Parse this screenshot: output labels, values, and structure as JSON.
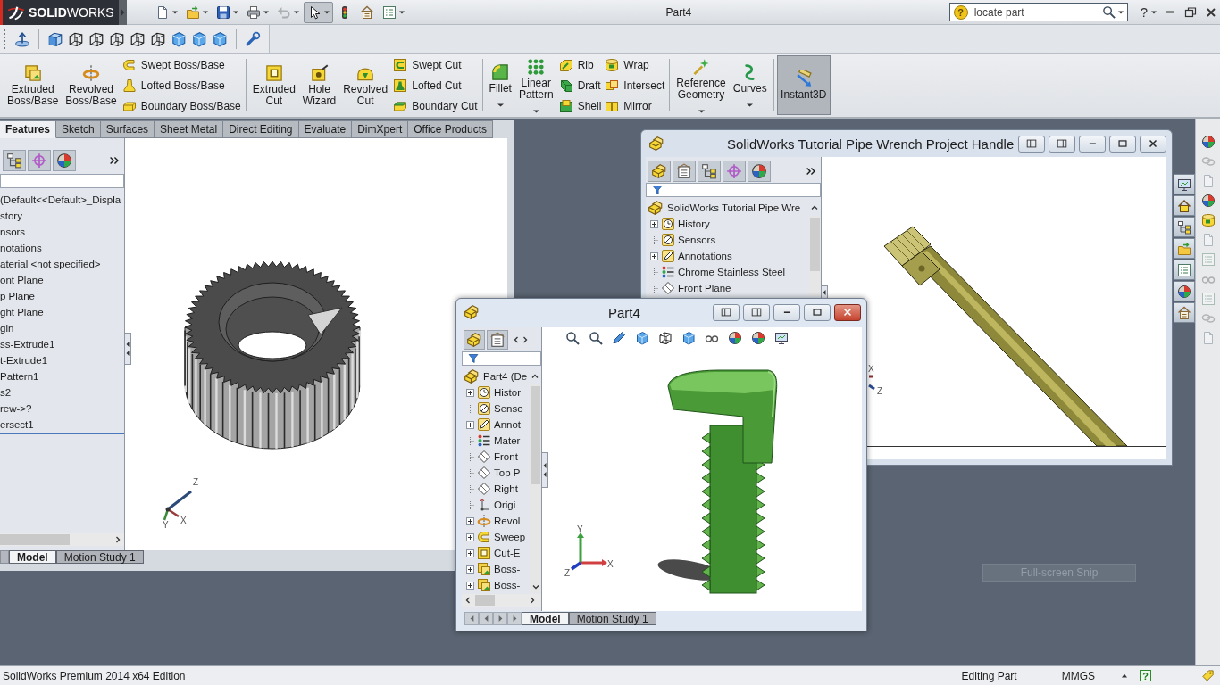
{
  "titlebar": {
    "logo": "**SOLID**WORKS",
    "title": "Part4",
    "search": {
      "help": "?",
      "placeholder": "locate part"
    },
    "help": "?"
  },
  "quick_access": [
    {
      "dropdown": true,
      "disabled": false,
      "pressed": false
    },
    {
      "dropdown": true,
      "disabled": false,
      "pressed": false
    },
    {
      "dropdown": true,
      "disabled": false,
      "pressed": false
    },
    {
      "dropdown": true,
      "disabled": false,
      "pressed": false
    },
    {
      "dropdown": true,
      "disabled": true,
      "pressed": false
    },
    {
      "dropdown": true,
      "disabled": false,
      "pressed": true
    },
    {
      "dropdown": false,
      "disabled": false,
      "pressed": false
    },
    {
      "dropdown": false,
      "disabled": false,
      "pressed": false
    },
    {
      "dropdown": true,
      "disabled": false,
      "pressed": false
    }
  ],
  "ribbon": {
    "groups": [
      {
        "items": [
          {
            "kind": "large",
            "label": "Extruded Boss/Base",
            "dropdown": false
          },
          {
            "kind": "large",
            "label": "Revolved Boss/Base",
            "dropdown": false
          },
          {
            "kind": "stack",
            "items": [
              "Swept Boss/Base",
              "Lofted Boss/Base",
              "Boundary Boss/Base"
            ]
          }
        ]
      },
      {
        "items": [
          {
            "kind": "large",
            "label": "Extruded Cut",
            "dropdown": false
          },
          {
            "kind": "large",
            "label": "Hole Wizard",
            "dropdown": false
          },
          {
            "kind": "large",
            "label": "Revolved Cut",
            "dropdown": false
          },
          {
            "kind": "stack",
            "items": [
              "Swept Cut",
              "Lofted Cut",
              "Boundary Cut"
            ]
          }
        ]
      },
      {
        "items": [
          {
            "kind": "large",
            "label": "Fillet",
            "dropdown": true
          },
          {
            "kind": "large",
            "label": "Linear Pattern",
            "dropdown": true
          },
          {
            "kind": "stack",
            "items": [
              "Rib",
              "Draft",
              "Shell"
            ]
          },
          {
            "kind": "stack",
            "items": [
              "Wrap",
              "Intersect",
              "Mirror"
            ]
          }
        ]
      },
      {
        "items": [
          {
            "kind": "large",
            "label": "Reference Geometry",
            "dropdown": true
          },
          {
            "kind": "large",
            "label": "Curves",
            "dropdown": true
          }
        ]
      }
    ],
    "toggle": {
      "label": "Instant3D",
      "on": true
    }
  },
  "tabs": [
    {
      "label": "Features",
      "selected": true
    },
    {
      "label": "Sketch",
      "selected": false
    },
    {
      "label": "Surfaces",
      "selected": false
    },
    {
      "label": "Sheet Metal",
      "selected": false
    },
    {
      "label": "Direct Editing",
      "selected": false
    },
    {
      "label": "Evaluate",
      "selected": false
    },
    {
      "label": "DimXpert",
      "selected": false
    },
    {
      "label": "Office Products",
      "selected": false
    }
  ],
  "main_document": {
    "tree": [
      "(Default<<Default>_Displa",
      "story",
      "nsors",
      "notations",
      "aterial <not specified>",
      "ont Plane",
      "p Plane",
      "ght Plane",
      "gin",
      "ss-Extrude1",
      "t-Extrude1",
      "Pattern1",
      "s2",
      "rew->?",
      "ersect1"
    ],
    "triad": [
      "Z",
      "X",
      "Y"
    ],
    "bottom_tabs": [
      {
        "label": "Model",
        "selected": true
      },
      {
        "label": "Motion Study 1",
        "selected": false
      }
    ]
  },
  "handle_window": {
    "title": "SolidWorks Tutorial Pipe Wrench Project Handle",
    "active": false,
    "tree": {
      "root": "SolidWorks Tutorial Pipe Wre",
      "items": [
        {
          "kind": "history",
          "label": "History",
          "expandable": true
        },
        {
          "kind": "sensors",
          "label": "Sensors",
          "expandable": false
        },
        {
          "kind": "annotations",
          "label": "Annotations",
          "expandable": true
        },
        {
          "kind": "material",
          "label": "Chrome Stainless Steel",
          "expandable": false
        },
        {
          "kind": "plane",
          "label": "Front Plane",
          "expandable": false
        }
      ]
    },
    "triad": [
      "X",
      "Z"
    ]
  },
  "part_window": {
    "title": "Part4",
    "active": true,
    "tree": {
      "root": "Part4 (De",
      "items": [
        {
          "kind": "history",
          "label": "Histor",
          "expandable": true
        },
        {
          "kind": "sensors",
          "label": "Senso",
          "expandable": false
        },
        {
          "kind": "annotations",
          "label": "Annot",
          "expandable": true
        },
        {
          "kind": "material",
          "label": "Mater",
          "expandable": false
        },
        {
          "kind": "plane",
          "label": "Front",
          "expandable": false
        },
        {
          "kind": "plane",
          "label": "Top P",
          "expandable": false
        },
        {
          "kind": "plane",
          "label": "Right",
          "expandable": false
        },
        {
          "kind": "origin",
          "label": "Origi",
          "expandable": false
        },
        {
          "kind": "revolve",
          "label": "Revol",
          "expandable": true
        },
        {
          "kind": "sweep",
          "label": "Sweep",
          "expandable": true
        },
        {
          "kind": "cut",
          "label": "Cut-E",
          "expandable": true
        },
        {
          "kind": "boss",
          "label": "Boss-",
          "expandable": true
        },
        {
          "kind": "boss",
          "label": "Boss-",
          "expandable": true
        }
      ]
    },
    "triad": [
      "Y",
      "X",
      "Z"
    ],
    "bottom_tabs": [
      {
        "label": "Model",
        "selected": true
      },
      {
        "label": "Motion Study 1",
        "selected": false
      }
    ]
  },
  "snip_button": "Full-screen Snip",
  "status_bar": {
    "edition": "SolidWorks Premium 2014 x64 Edition",
    "mode": "Editing Part",
    "units": "MMGS",
    "help": "?"
  }
}
